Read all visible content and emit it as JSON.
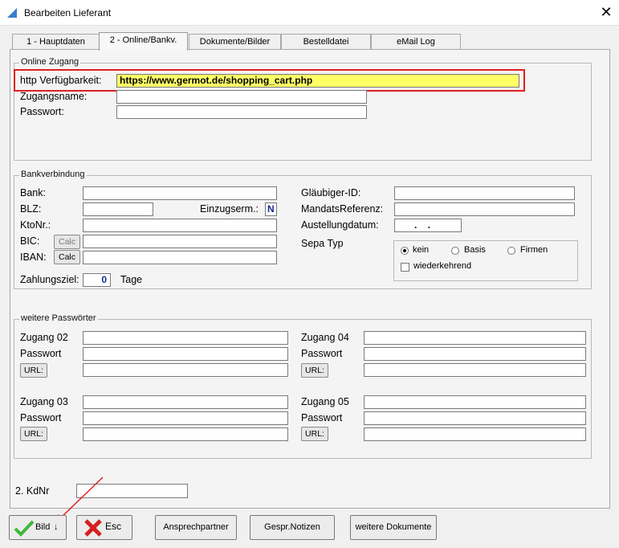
{
  "window": {
    "title": "Bearbeiten Lieferant",
    "close_glyph": "✕"
  },
  "tabs": [
    {
      "label": "1 - Hauptdaten"
    },
    {
      "label": "2 - Online/Bankv."
    },
    {
      "label": "Dokumente/Bilder"
    },
    {
      "label": "Bestelldatei"
    },
    {
      "label": "eMail Log"
    }
  ],
  "online": {
    "legend": "Online Zugang",
    "http_label": "http Verfügbarkeit:",
    "http_value": "https://www.germot.de/shopping_cart.php",
    "zugangsname_label": "Zugangsname:",
    "zugangsname_value": "",
    "passwort_label": "Passwort:",
    "passwort_value": ""
  },
  "bank": {
    "legend": "Bankverbindung",
    "bank_label": "Bank:",
    "blz_label": "BLZ:",
    "einzug_label": "Einzugserm.:",
    "einzug_value": "N",
    "kto_label": "KtoNr.:",
    "bic_label": "BIC:",
    "iban_label": "IBAN:",
    "calc_label": "Calc",
    "zahlungsziel_label": "Zahlungsziel:",
    "zahlungsziel_value": "0",
    "tage_label": "Tage",
    "glaeubiger_label": "Gläubiger-ID:",
    "mandats_label": "MandatsReferenz:",
    "ausstellung_label": "Austellungdatum:",
    "ausstellung_value": ".    .",
    "sepa_label": "Sepa Typ",
    "sepa_options": [
      "kein",
      "Basis",
      "Firmen"
    ],
    "sepa_selected": "kein",
    "wiederkehrend_label": "wiederkehrend",
    "wiederkehrend_checked": false
  },
  "passwords": {
    "legend": "weitere Passwörter",
    "zugang02_label": "Zugang 02",
    "zugang03_label": "Zugang 03",
    "zugang04_label": "Zugang 04",
    "zugang05_label": "Zugang 05",
    "passwort_label": "Passwort",
    "url_label": "URL:"
  },
  "kdnr": {
    "label": "2. KdNr",
    "value": ""
  },
  "buttons": {
    "bild": "Bild",
    "bild_arrow": "↓",
    "esc": "Esc",
    "ansprechpartner": "Ansprechpartner",
    "gespr_notizen": "Gespr.Notizen",
    "weitere_dokumente": "weitere Dokumente"
  },
  "colors": {
    "highlight_field": "#ffff66",
    "annotation_red": "#e02020",
    "check_green": "#3cb83c",
    "esc_red": "#d42020"
  }
}
